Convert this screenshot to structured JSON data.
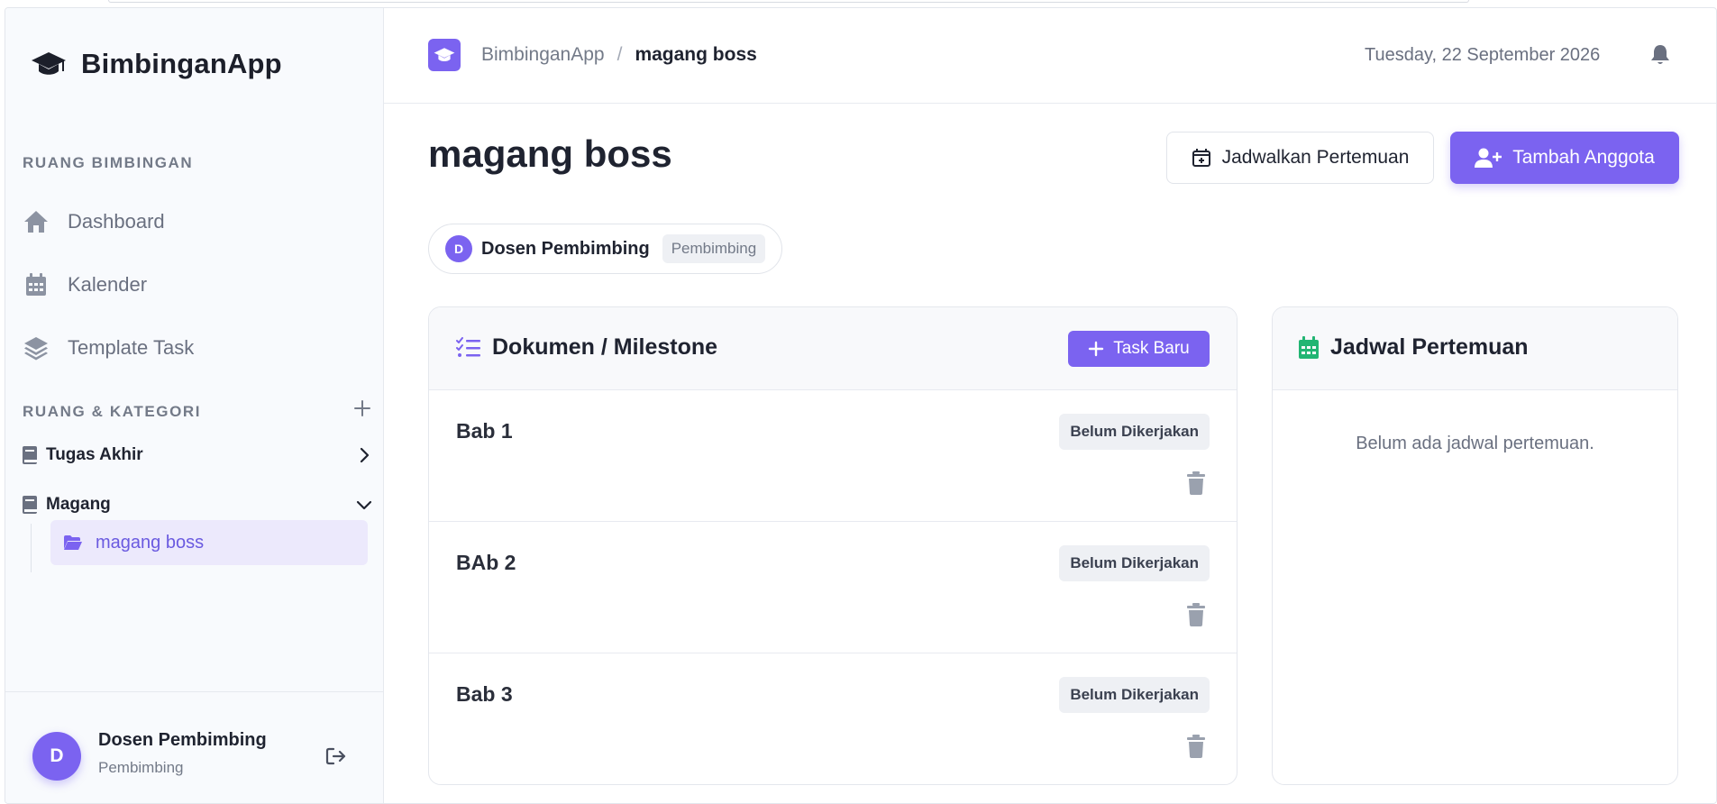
{
  "brand": {
    "title": "BimbinganApp",
    "icon": "graduation-cap-icon"
  },
  "sidebar": {
    "section_main": "RUANG BIMBINGAN",
    "nav": [
      {
        "label": "Dashboard",
        "icon": "home-icon"
      },
      {
        "label": "Kalender",
        "icon": "calendar-icon"
      },
      {
        "label": "Template Task",
        "icon": "layers-icon"
      }
    ],
    "section_categories": "RUANG & KATEGORI",
    "categories": [
      {
        "label": "Tugas Akhir",
        "expanded": false
      },
      {
        "label": "Magang",
        "expanded": true,
        "children": [
          {
            "label": "magang boss",
            "active": true
          }
        ]
      }
    ],
    "user": {
      "initial": "D",
      "name": "Dosen Pembimbing",
      "role": "Pembimbing"
    }
  },
  "header": {
    "breadcrumb_root": "BimbinganApp",
    "breadcrumb_sep": "/",
    "breadcrumb_current": "magang boss",
    "date": "Tuesday, 22 September 2026"
  },
  "main": {
    "title": "magang boss",
    "schedule_button": "Jadwalkan Pertemuan",
    "add_member_button": "Tambah Anggota",
    "member": {
      "initial": "D",
      "name": "Dosen Pembimbing",
      "role": "Pembimbing"
    },
    "documents": {
      "title": "Dokumen / Milestone",
      "new_task_button": "Task Baru",
      "tasks": [
        {
          "name": "Bab 1",
          "status": "Belum Dikerjakan"
        },
        {
          "name": "BAb 2",
          "status": "Belum Dikerjakan"
        },
        {
          "name": "Bab 3",
          "status": "Belum Dikerjakan"
        }
      ]
    },
    "schedule": {
      "title": "Jadwal Pertemuan",
      "empty": "Belum ada jadwal pertemuan."
    }
  },
  "colors": {
    "accent": "#7b63f0",
    "calendar_green": "#22b573",
    "text": "#1f2330",
    "muted": "#737a88"
  }
}
